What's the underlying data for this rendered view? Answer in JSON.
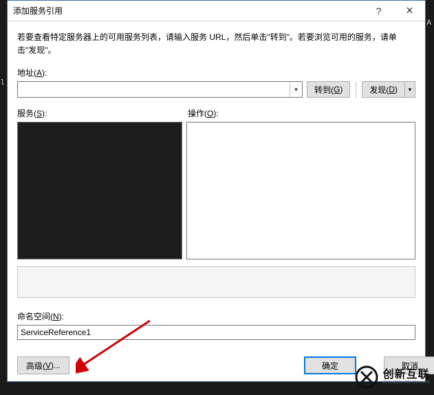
{
  "title": "添加服务引用",
  "titlebar": {
    "help": "?",
    "close": "×"
  },
  "instructions": "若要查看特定服务器上的可用服务列表，请输入服务 URL，然后单击\"转到\"。若要浏览可用的服务，请单击\"发现\"。",
  "address": {
    "label_prefix": "地址(",
    "label_key": "A",
    "label_suffix": "):",
    "value": "",
    "go_label_prefix": "转到(",
    "go_label_key": "G",
    "go_label_suffix": ")",
    "discover_label_prefix": "发现(",
    "discover_label_key": "D",
    "discover_label_suffix": ")"
  },
  "lists": {
    "services_label_prefix": "服务(",
    "services_label_key": "S",
    "services_label_suffix": "):",
    "ops_label_prefix": "操作(",
    "ops_label_key": "O",
    "ops_label_suffix": "):"
  },
  "namespace": {
    "label_prefix": "命名空间(",
    "label_key": "N",
    "label_suffix": "):",
    "value": "ServiceReference1"
  },
  "footer": {
    "advanced_prefix": "高级(",
    "advanced_key": "V",
    "advanced_suffix": ")...",
    "ok": "确定",
    "cancel": "取消"
  },
  "logo": {
    "cn": "创新互联",
    "en": "CHUANG XIN HU LIAN"
  }
}
